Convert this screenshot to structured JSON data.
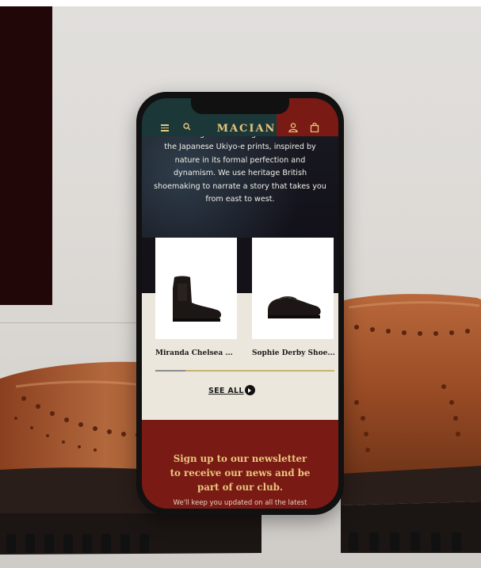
{
  "app": {
    "logo": "MACIAN",
    "icons": [
      "hamburger-menu-icon",
      "search-icon",
      "user-icon",
      "shopping-bag-icon"
    ]
  },
  "hero": {
    "text_line_0": "contrasting voids. Taking references from",
    "text_line_1": "the Japanese Ukiyo-e prints, inspired by",
    "text_line_2": "nature in its formal perfection and",
    "text_line_3": "dynamism. We use heritage British",
    "text_line_4": "shoemaking to narrate a story that takes you",
    "text_line_5": "from east to west."
  },
  "products": {
    "items": [
      {
        "name": "Miranda Chelsea ..."
      },
      {
        "name": "Sophie Derby Shoe..."
      }
    ],
    "scroll_progress": 0.17,
    "see_all_label": "SEE ALL"
  },
  "newsletter": {
    "title_line_0": "Sign up to our newsletter",
    "title_line_1": "to receive our news and be",
    "title_line_2": "part of our club.",
    "subtitle": "We'll keep you updated on all the latest"
  },
  "colors": {
    "header_teal": "#1c3737",
    "brand_red": "#7a1a14",
    "gold": "#e9c77e",
    "cream": "#ece7dc",
    "dark_block": "#220708"
  }
}
